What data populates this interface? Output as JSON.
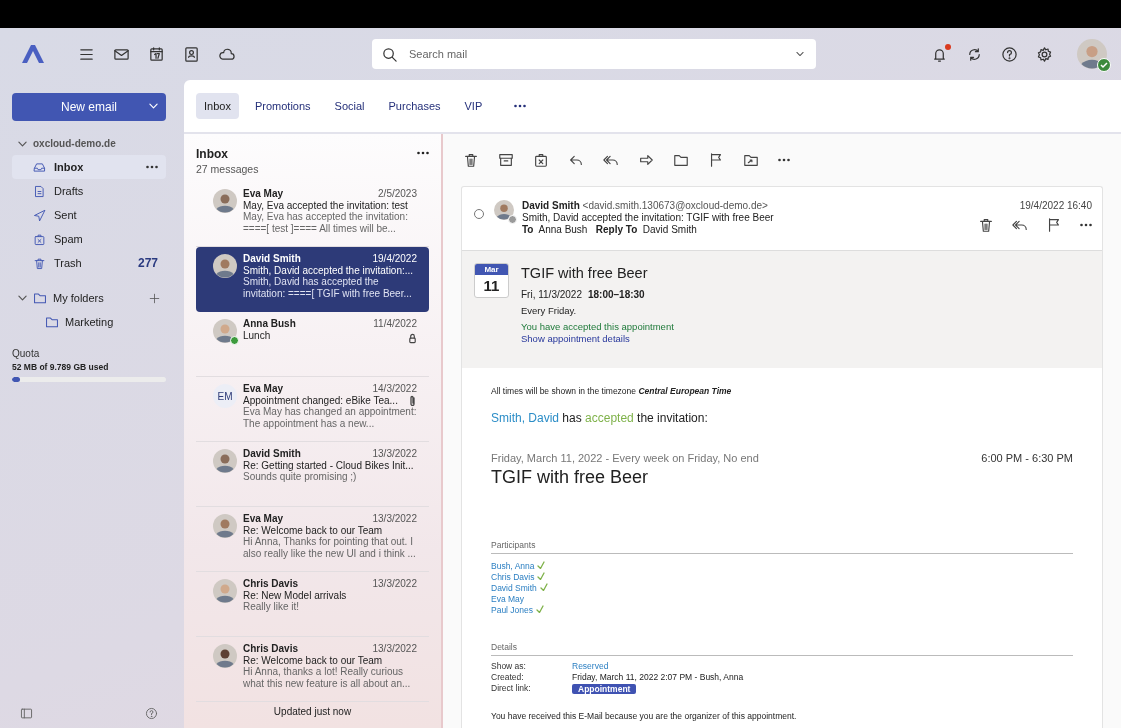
{
  "header": {
    "search": {
      "placeholder": "Search mail"
    },
    "notifications": {
      "unread": true
    },
    "user": {
      "online": true
    }
  },
  "sidebar": {
    "new_email": "New email",
    "account": {
      "name": "oxcloud-demo.de",
      "expanded": true
    },
    "folders": [
      {
        "kind": "inbox",
        "label": "Inbox",
        "selected": true
      },
      {
        "kind": "drafts",
        "label": "Drafts",
        "selected": false
      },
      {
        "kind": "sent",
        "label": "Sent",
        "selected": false
      },
      {
        "kind": "spam",
        "label": "Spam",
        "selected": false
      },
      {
        "kind": "trash",
        "label": "Trash",
        "selected": false,
        "count": "277"
      }
    ],
    "my_folders": {
      "label": "My folders",
      "expanded": true,
      "children": [
        {
          "label": "Marketing"
        }
      ]
    },
    "quota": {
      "title": "Quota",
      "usage": "52 MB of 9.789 GB used",
      "level": 0.05
    }
  },
  "tabs": [
    {
      "label": "Inbox",
      "selected": true
    },
    {
      "label": "Promotions",
      "selected": false
    },
    {
      "label": "Social",
      "selected": false
    },
    {
      "label": "Purchases",
      "selected": false
    },
    {
      "label": "VIP",
      "selected": false
    }
  ],
  "list": {
    "title": "Inbox",
    "count": "27 messages",
    "footer": "Updated just now",
    "messages": [
      {
        "from": "Eva May",
        "date": "2/5/2023",
        "subject": "May, Eva accepted the invitation: test",
        "preview": "May, Eva has accepted the invitation: ====[ test ]==== All times will be...",
        "selected": false
      },
      {
        "from": "David Smith",
        "date": "19/4/2022",
        "subject": "Smith, David accepted the invitation:...",
        "preview": "Smith, David has accepted the invitation: ====[ TGIF with free Beer...",
        "selected": true
      },
      {
        "from": "Anna Bush",
        "date": "11/4/2022",
        "subject": "Lunch",
        "online": true,
        "locked": true,
        "selected": false
      },
      {
        "from": "Eva May",
        "date": "14/3/2022",
        "subject": "Appointment changed: eBike Tea...",
        "preview": "Eva May has changed an appointment: The appointment has a new...",
        "initials": "EM",
        "has_attachment": true,
        "selected": false
      },
      {
        "from": "David Smith",
        "date": "13/3/2022",
        "subject": "Re: Getting started - Cloud Bikes Init...",
        "preview": "Sounds quite promising ;)",
        "selected": false
      },
      {
        "from": "Eva May",
        "date": "13/3/2022",
        "subject": "Re: Welcome back to our Team",
        "preview": "Hi Anna, Thanks for pointing that out. I also really like the new UI and i think ...",
        "selected": false
      },
      {
        "from": "Chris Davis",
        "date": "13/3/2022",
        "subject": "Re: New Model arrivals",
        "preview": "Really like it!",
        "selected": false
      },
      {
        "from": "Chris Davis",
        "date": "13/3/2022",
        "subject": "Re: Welcome back to our Team",
        "preview": "Hi Anna, thanks a lot! Really curious what this new feature is all about an...",
        "selected": false
      }
    ]
  },
  "mail": {
    "selected": false,
    "from": "David Smith",
    "address": "<david.smith.130673@oxcloud-demo.de>",
    "subject": "Smith, David accepted the invitation: TGIF with free Beer",
    "to_label": "To",
    "to": "Anna Bush",
    "reply_label": "Reply To",
    "reply_to": "David Smith",
    "date": "19/4/2022 16:40",
    "online": false,
    "appointment": {
      "month": "Mar",
      "day": "11",
      "title": "TGIF with free Beer",
      "date": "Fri, 11/3/2022",
      "time": "18:00–18:30",
      "recurrence": "Every Friday.",
      "status": "You have accepted this appointment",
      "details_link": "Show appointment details"
    },
    "body": {
      "timezone_note": "All times will be shown in the timezone **Central European Time**",
      "sentence": {
        "actor": "Smith, David",
        "verb": "has",
        "status": "accepted",
        "rest": "the invitation:"
      },
      "when": "Friday, March 11, 2022 - Every week on Friday, No end",
      "time": "6:00 PM - 6:30 PM",
      "title": "TGIF with free Beer",
      "participants_label": "Participants",
      "participants": [
        {
          "name": "Bush, Anna",
          "accepted": true
        },
        {
          "name": "Chris Davis",
          "accepted": true
        },
        {
          "name": "David Smith",
          "accepted": true
        },
        {
          "name": "Eva May",
          "accepted": false
        },
        {
          "name": "Paul Jones",
          "accepted": true
        }
      ],
      "details_label": "Details",
      "details": [
        {
          "label": "Show as:",
          "value": "Reserved",
          "kind": "link"
        },
        {
          "label": "Created:",
          "value": "Friday, March 11, 2022 2:07 PM - Bush, Anna",
          "kind": "text"
        },
        {
          "label": "Direct link:",
          "value": "Appointment",
          "kind": "badge"
        }
      ],
      "footer": "You have received this E-Mail because you are the organizer of this appointment."
    }
  }
}
